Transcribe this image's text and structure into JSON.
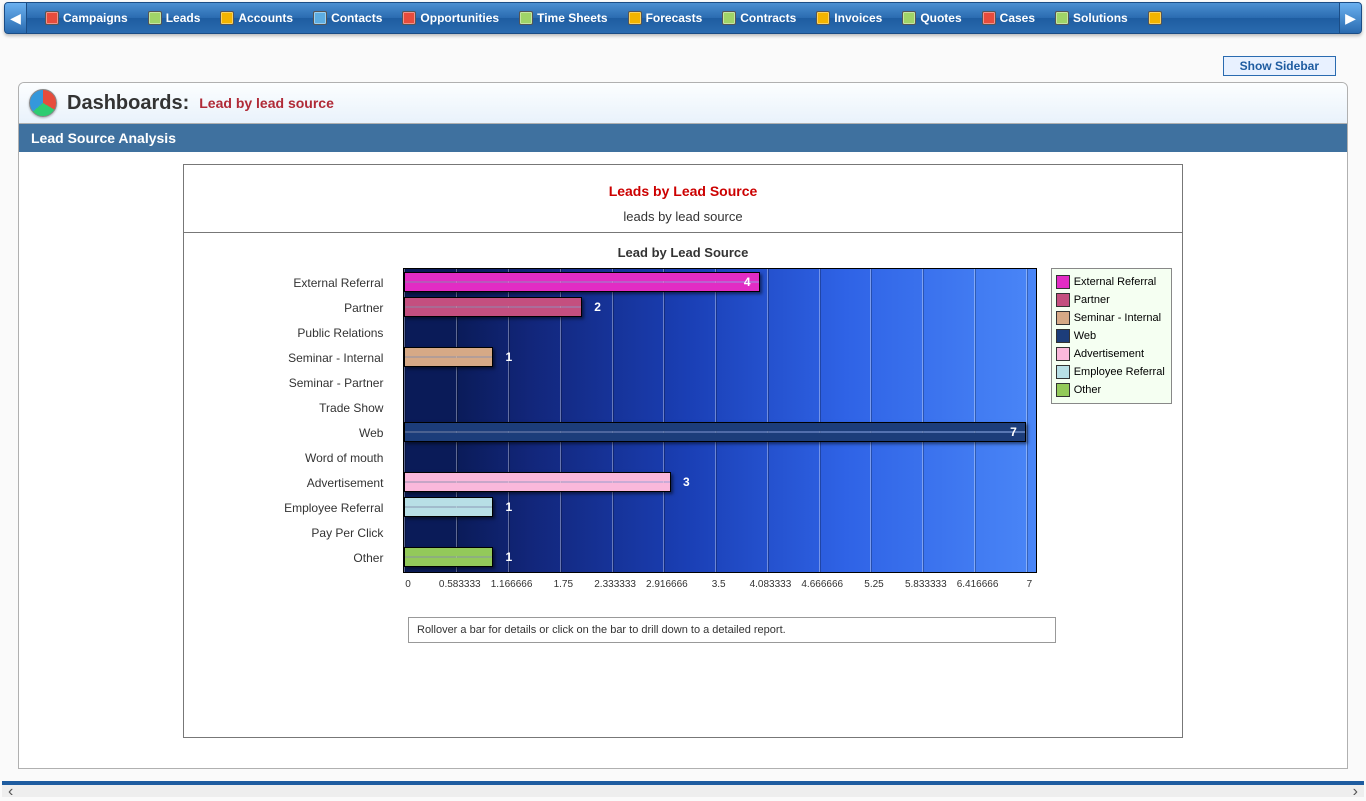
{
  "nav": {
    "items": [
      {
        "label": "Campaigns"
      },
      {
        "label": "Leads"
      },
      {
        "label": "Accounts"
      },
      {
        "label": "Contacts"
      },
      {
        "label": "Opportunities"
      },
      {
        "label": "Time Sheets"
      },
      {
        "label": "Forecasts"
      },
      {
        "label": "Contracts"
      },
      {
        "label": "Invoices"
      },
      {
        "label": "Quotes"
      },
      {
        "label": "Cases"
      },
      {
        "label": "Solutions"
      }
    ]
  },
  "sidebar_toggle": "Show Sidebar",
  "page": {
    "heading_prefix": "Dashboards:",
    "heading_suffix": "Lead by lead source",
    "section": "Lead Source Analysis"
  },
  "chart_panel": {
    "top_title": "Leads by Lead Source",
    "top_subtitle": "leads by lead source",
    "hint": "Rollover a bar for details or click on the bar to drill down to a detailed report."
  },
  "legend": [
    {
      "label": "External Referral",
      "color": "#e22cc4"
    },
    {
      "label": "Partner",
      "color": "#c44f7f"
    },
    {
      "label": "Seminar - Internal",
      "color": "#d6a986"
    },
    {
      "label": "Web",
      "color": "#1c3d7a"
    },
    {
      "label": "Advertisement",
      "color": "#fab8db"
    },
    {
      "label": "Employee Referral",
      "color": "#b8dfe6"
    },
    {
      "label": "Other",
      "color": "#93c95a"
    }
  ],
  "chart_data": {
    "type": "bar",
    "title": "Lead by Lead Source",
    "orientation": "horizontal",
    "xlabel": "",
    "ylabel": "",
    "xlim": [
      0,
      7.3
    ],
    "x_ticks": [
      0,
      0.583333,
      1.166666,
      1.75,
      2.333333,
      2.916666,
      3.5,
      4.083333,
      4.666666,
      5.25,
      5.833333,
      6.416666,
      7
    ],
    "categories": [
      "External Referral",
      "Partner",
      "Public Relations",
      "Seminar - Internal",
      "Seminar - Partner",
      "Trade Show",
      "Web",
      "Word of mouth",
      "Advertisement",
      "Employee Referral",
      "Pay Per Click",
      "Other"
    ],
    "values": [
      4,
      2,
      0,
      1,
      0,
      0,
      7,
      0,
      3,
      1,
      0,
      1
    ],
    "colors": [
      "#e22cc4",
      "#c44f7f",
      "",
      "#d6a986",
      "",
      "",
      "#1c3d7a",
      "",
      "#fab8db",
      "#b8dfe6",
      "",
      "#93c95a"
    ]
  }
}
